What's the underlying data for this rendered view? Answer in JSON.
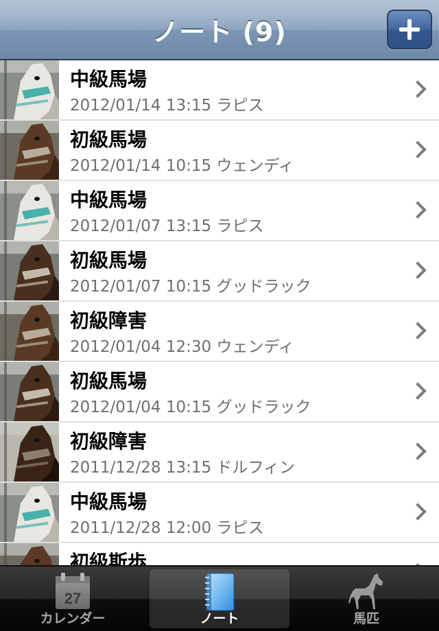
{
  "navbar": {
    "title": "ノート (9)",
    "add_icon": "plus-icon"
  },
  "notes": [
    {
      "title": "中級馬場",
      "subtitle": "2012/01/14 13:15 ラピス",
      "horse": "white"
    },
    {
      "title": "初級馬場",
      "subtitle": "2012/01/14 10:15 ウェンディ",
      "horse": "brown"
    },
    {
      "title": "中級馬場",
      "subtitle": "2012/01/07 13:15 ラピス",
      "horse": "white"
    },
    {
      "title": "初級馬場",
      "subtitle": "2012/01/07 10:15 グッドラック",
      "horse": "bay"
    },
    {
      "title": "初級障害",
      "subtitle": "2012/01/04 12:30 ウェンディ",
      "horse": "brown"
    },
    {
      "title": "初級馬場",
      "subtitle": "2012/01/04 10:15 グッドラック",
      "horse": "bay"
    },
    {
      "title": "初級障害",
      "subtitle": "2011/12/28 13:15 ドルフィン",
      "horse": "dark"
    },
    {
      "title": "中級馬場",
      "subtitle": "2011/12/28 12:00 ラピス",
      "horse": "white"
    },
    {
      "title": "初級斯歩",
      "subtitle": "",
      "horse": "brown"
    }
  ],
  "tabbar": {
    "tabs": [
      {
        "label": "カレンダー",
        "icon": "calendar-icon",
        "icon_text": "27"
      },
      {
        "label": "ノート",
        "icon": "notebook-icon"
      },
      {
        "label": "馬匹",
        "icon": "horse-icon"
      }
    ],
    "selected_index": 1
  },
  "colors": {
    "navbar": "#7d96b4",
    "add_button": "#40669e",
    "subtitle_text": "#6e6e6e",
    "tabbar": "#1a1a1a"
  }
}
